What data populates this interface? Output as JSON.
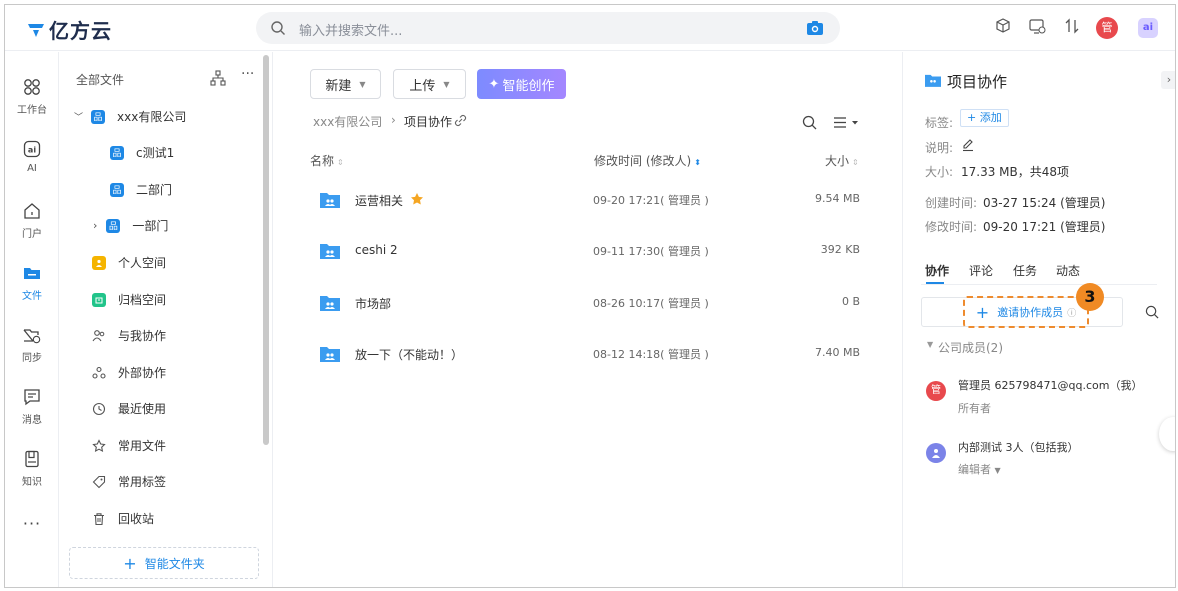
{
  "app": {
    "brand": "亿方云"
  },
  "search": {
    "placeholder": "输入并搜索文件..."
  },
  "header": {
    "avatar_text": "管",
    "ai_badge": "ai"
  },
  "rail": [
    {
      "label": "工作台",
      "icon": "grid-icon"
    },
    {
      "label": "AI",
      "icon": "ai-icon"
    },
    {
      "label": "门户",
      "icon": "home-icon"
    },
    {
      "label": "文件",
      "icon": "folder-icon",
      "active": true
    },
    {
      "label": "同步",
      "icon": "sync-folder-icon"
    },
    {
      "label": "消息",
      "icon": "message-icon"
    },
    {
      "label": "知识",
      "icon": "knowledge-icon"
    }
  ],
  "tree": {
    "title": "全部文件",
    "company": "xxx有限公司",
    "departments": [
      "c测试1",
      "二部门",
      "一部门"
    ],
    "items": [
      {
        "label": "个人空间",
        "icon": "personal-space-icon"
      },
      {
        "label": "归档空间",
        "icon": "archive-space-icon"
      },
      {
        "label": "与我协作",
        "icon": "collab-icon"
      },
      {
        "label": "外部协作",
        "icon": "external-collab-icon"
      },
      {
        "label": "最近使用",
        "icon": "clock-icon"
      },
      {
        "label": "常用文件",
        "icon": "star-icon"
      },
      {
        "label": "常用标签",
        "icon": "tag-icon"
      },
      {
        "label": "回收站",
        "icon": "trash-icon"
      }
    ],
    "smart_folder": "智能文件夹"
  },
  "toolbar": {
    "new": "新建",
    "upload": "上传",
    "ai_create": "智能创作"
  },
  "breadcrumb": {
    "root": "xxx有限公司",
    "current": "项目协作"
  },
  "table": {
    "headers": {
      "name": "名称",
      "modified": "修改时间 (修改人)",
      "size": "大小"
    },
    "rows": [
      {
        "name": "运营相关",
        "modified": "09-20 17:21( 管理员 )",
        "size": "9.54 MB",
        "starred": true
      },
      {
        "name": "ceshi 2",
        "modified": "09-11 17:30( 管理员 )",
        "size": "392 KB"
      },
      {
        "name": "市场部",
        "modified": "08-26 10:17( 管理员 )",
        "size": "0 B"
      },
      {
        "name": "放一下（不能动！）",
        "modified": "08-12 14:18( 管理员 )",
        "size": "7.40 MB"
      }
    ]
  },
  "panel": {
    "title": "项目协作",
    "tag_label": "标签:",
    "tag_add": "+ 添加",
    "desc_label": "说明:",
    "size_label": "大小:",
    "size_value": "17.33 MB，共48项",
    "created_label": "创建时间:",
    "created_value": "03-27 15:24 (管理员)",
    "modified_label": "修改时间:",
    "modified_value": "09-20 17:21 (管理员)",
    "tabs": [
      "协作",
      "评论",
      "任务",
      "动态"
    ],
    "invite": "邀请协作成员",
    "step": "3",
    "members_group": "公司成员(2)",
    "members": [
      {
        "avatar": "管",
        "name": "管理员  625798471@qq.com（我）",
        "role": "所有者",
        "color": "#e8494d"
      },
      {
        "avatar": "",
        "name": "内部测试  3人（包括我）",
        "role": "编辑者",
        "color": "#7b83e8"
      }
    ]
  }
}
